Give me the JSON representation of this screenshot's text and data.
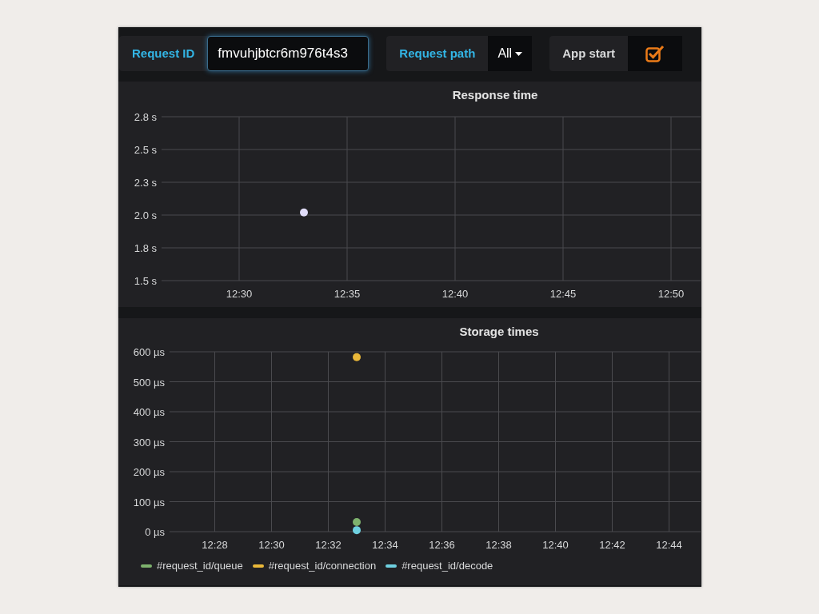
{
  "variables": [
    {
      "kind": "text",
      "label": "Request ID",
      "value": "fmvuhjbtcr6m976t4s3",
      "focused": true
    },
    {
      "kind": "select",
      "label": "Request path",
      "value": "All"
    },
    {
      "kind": "checkbox",
      "label": "App start",
      "checked": true
    }
  ],
  "panels": [
    {
      "chart_data": {
        "type": "scatter",
        "title": "Response time",
        "grid": true,
        "ylim": [
          1.5,
          2.75
        ],
        "categories": [
          null,
          null,
          null,
          "12:30",
          null,
          null,
          null,
          null,
          "12:35",
          null,
          null,
          null,
          null,
          "12:40",
          null,
          null,
          null,
          null,
          "12:45",
          null,
          null,
          null,
          null,
          "12:50",
          null
        ],
        "yticks": [
          {
            "value": 1.5,
            "label": "1.5 s"
          },
          {
            "value": 1.75,
            "label": "1.8 s"
          },
          {
            "value": 2,
            "label": "2.0 s"
          },
          {
            "value": 2.25,
            "label": "2.3 s"
          },
          {
            "value": 2.5,
            "label": "2.5 s"
          },
          {
            "value": 2.75,
            "label": "2.8 s"
          }
        ],
        "series": [
          {
            "color": "#e0dcf8",
            "values": [
              null,
              null,
              null,
              null,
              null,
              null,
              2.02,
              null,
              null,
              null,
              null,
              null,
              null,
              null,
              null,
              null,
              null,
              null,
              null,
              null,
              null,
              null,
              null,
              null,
              null
            ]
          }
        ]
      }
    },
    {
      "chart_data": {
        "type": "scatter",
        "title": "Storage times",
        "grid": true,
        "ylim": [
          0,
          600
        ],
        "categories": [
          null,
          "12:28",
          null,
          "12:30",
          null,
          "12:32",
          null,
          "12:34",
          null,
          "12:36",
          null,
          "12:38",
          null,
          "12:40",
          null,
          "12:42",
          null,
          "12:44",
          null
        ],
        "yticks": [
          {
            "value": 0,
            "label": "0 µs"
          },
          {
            "value": 100,
            "label": "100 µs"
          },
          {
            "value": 200,
            "label": "200 µs"
          },
          {
            "value": 300,
            "label": "300 µs"
          },
          {
            "value": 400,
            "label": "400 µs"
          },
          {
            "value": 500,
            "label": "500 µs"
          },
          {
            "value": 600,
            "label": "600 µs"
          }
        ],
        "series": [
          {
            "name": "#request_id/queue",
            "color": "#7eb26d",
            "values": [
              null,
              null,
              null,
              null,
              null,
              null,
              32,
              null,
              null,
              null,
              null,
              null,
              null,
              null,
              null,
              null,
              null,
              null,
              null
            ]
          },
          {
            "name": "#request_id/connection",
            "color": "#eab839",
            "values": [
              null,
              null,
              null,
              null,
              null,
              null,
              582,
              null,
              null,
              null,
              null,
              null,
              null,
              null,
              null,
              null,
              null,
              null,
              null
            ]
          },
          {
            "name": "#request_id/decode",
            "color": "#6ed0e0",
            "values": [
              null,
              null,
              null,
              null,
              null,
              null,
              5,
              null,
              null,
              null,
              null,
              null,
              null,
              null,
              null,
              null,
              null,
              null,
              null
            ]
          }
        ]
      }
    }
  ]
}
